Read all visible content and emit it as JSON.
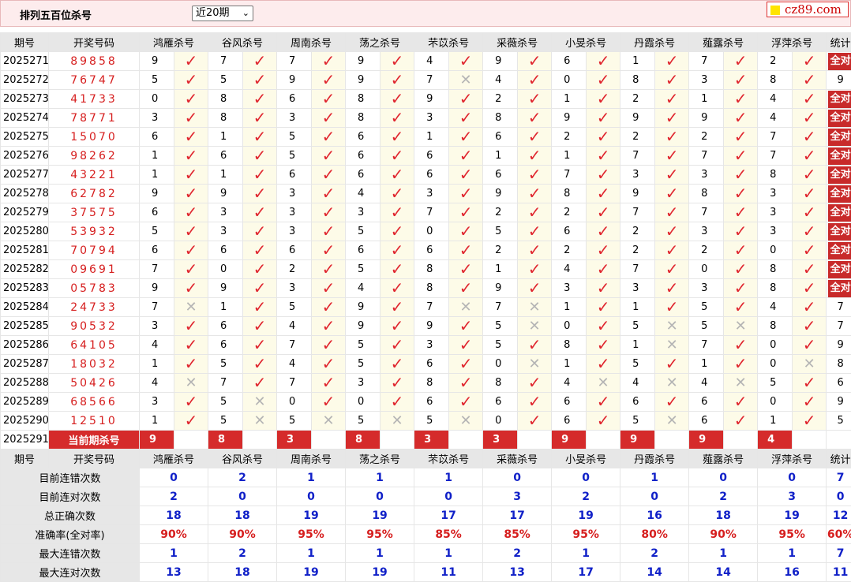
{
  "header": {
    "title": "排列五百位杀号",
    "period_select": "近20期",
    "logo_text": "cz89.com"
  },
  "columns": {
    "issue": "期号",
    "award": "开奖号码",
    "killers": [
      "鸿雁杀号",
      "谷风杀号",
      "周南杀号",
      "荡之杀号",
      "芣苡杀号",
      "采薇杀号",
      "小旻杀号",
      "丹霞杀号",
      "薤露杀号",
      "浮萍杀号"
    ],
    "stat": "统计"
  },
  "rows": [
    {
      "issue": "2025271",
      "award": "89858",
      "kills": [
        9,
        7,
        7,
        9,
        4,
        9,
        6,
        1,
        7,
        2
      ],
      "res": [
        1,
        1,
        1,
        1,
        1,
        1,
        1,
        1,
        1,
        1
      ],
      "stat": "全对"
    },
    {
      "issue": "2025272",
      "award": "76747",
      "kills": [
        5,
        5,
        9,
        9,
        7,
        4,
        0,
        8,
        3,
        8
      ],
      "res": [
        1,
        1,
        1,
        1,
        0,
        1,
        1,
        1,
        1,
        1
      ],
      "stat": "9"
    },
    {
      "issue": "2025273",
      "award": "41733",
      "kills": [
        0,
        8,
        6,
        8,
        9,
        2,
        1,
        2,
        1,
        4
      ],
      "res": [
        1,
        1,
        1,
        1,
        1,
        1,
        1,
        1,
        1,
        1
      ],
      "stat": "全对"
    },
    {
      "issue": "2025274",
      "award": "78771",
      "kills": [
        3,
        8,
        3,
        8,
        3,
        8,
        9,
        9,
        9,
        4
      ],
      "res": [
        1,
        1,
        1,
        1,
        1,
        1,
        1,
        1,
        1,
        1
      ],
      "stat": "全对"
    },
    {
      "issue": "2025275",
      "award": "15070",
      "kills": [
        6,
        1,
        5,
        6,
        1,
        6,
        2,
        2,
        2,
        7
      ],
      "res": [
        1,
        1,
        1,
        1,
        1,
        1,
        1,
        1,
        1,
        1
      ],
      "stat": "全对"
    },
    {
      "issue": "2025276",
      "award": "98262",
      "kills": [
        1,
        6,
        5,
        6,
        6,
        1,
        1,
        7,
        7,
        7
      ],
      "res": [
        1,
        1,
        1,
        1,
        1,
        1,
        1,
        1,
        1,
        1
      ],
      "stat": "全对"
    },
    {
      "issue": "2025277",
      "award": "43221",
      "kills": [
        1,
        1,
        6,
        6,
        6,
        6,
        7,
        3,
        3,
        8
      ],
      "res": [
        1,
        1,
        1,
        1,
        1,
        1,
        1,
        1,
        1,
        1
      ],
      "stat": "全对"
    },
    {
      "issue": "2025278",
      "award": "62782",
      "kills": [
        9,
        9,
        3,
        4,
        3,
        9,
        8,
        9,
        8,
        3
      ],
      "res": [
        1,
        1,
        1,
        1,
        1,
        1,
        1,
        1,
        1,
        1
      ],
      "stat": "全对"
    },
    {
      "issue": "2025279",
      "award": "37575",
      "kills": [
        6,
        3,
        3,
        3,
        7,
        2,
        2,
        7,
        7,
        3
      ],
      "res": [
        1,
        1,
        1,
        1,
        1,
        1,
        1,
        1,
        1,
        1
      ],
      "stat": "全对"
    },
    {
      "issue": "2025280",
      "award": "53932",
      "kills": [
        5,
        3,
        3,
        5,
        0,
        5,
        6,
        2,
        3,
        3
      ],
      "res": [
        1,
        1,
        1,
        1,
        1,
        1,
        1,
        1,
        1,
        1
      ],
      "stat": "全对"
    },
    {
      "issue": "2025281",
      "award": "70794",
      "kills": [
        6,
        6,
        6,
        6,
        6,
        2,
        2,
        2,
        2,
        0
      ],
      "res": [
        1,
        1,
        1,
        1,
        1,
        1,
        1,
        1,
        1,
        1
      ],
      "stat": "全对"
    },
    {
      "issue": "2025282",
      "award": "09691",
      "kills": [
        7,
        0,
        2,
        5,
        8,
        1,
        4,
        7,
        0,
        8
      ],
      "res": [
        1,
        1,
        1,
        1,
        1,
        1,
        1,
        1,
        1,
        1
      ],
      "stat": "全对"
    },
    {
      "issue": "2025283",
      "award": "05783",
      "kills": [
        9,
        9,
        3,
        4,
        8,
        9,
        3,
        3,
        3,
        8
      ],
      "res": [
        1,
        1,
        1,
        1,
        1,
        1,
        1,
        1,
        1,
        1
      ],
      "stat": "全对"
    },
    {
      "issue": "2025284",
      "award": "24733",
      "kills": [
        7,
        1,
        5,
        9,
        7,
        7,
        1,
        1,
        5,
        4
      ],
      "res": [
        0,
        1,
        1,
        1,
        0,
        0,
        1,
        1,
        1,
        1
      ],
      "stat": "7"
    },
    {
      "issue": "2025285",
      "award": "90532",
      "kills": [
        3,
        6,
        4,
        9,
        9,
        5,
        0,
        5,
        5,
        8
      ],
      "res": [
        1,
        1,
        1,
        1,
        1,
        0,
        1,
        0,
        0,
        1
      ],
      "stat": "7"
    },
    {
      "issue": "2025286",
      "award": "64105",
      "kills": [
        4,
        6,
        7,
        5,
        3,
        5,
        8,
        1,
        7,
        0
      ],
      "res": [
        1,
        1,
        1,
        1,
        1,
        1,
        1,
        0,
        1,
        1
      ],
      "stat": "9"
    },
    {
      "issue": "2025287",
      "award": "18032",
      "kills": [
        1,
        5,
        4,
        5,
        6,
        0,
        1,
        5,
        1,
        0
      ],
      "res": [
        1,
        1,
        1,
        1,
        1,
        0,
        1,
        1,
        1,
        0
      ],
      "stat": "8"
    },
    {
      "issue": "2025288",
      "award": "50426",
      "kills": [
        4,
        7,
        7,
        3,
        8,
        8,
        4,
        4,
        4,
        5
      ],
      "res": [
        0,
        1,
        1,
        1,
        1,
        1,
        0,
        0,
        0,
        1
      ],
      "stat": "6"
    },
    {
      "issue": "2025289",
      "award": "68566",
      "kills": [
        3,
        5,
        0,
        0,
        6,
        6,
        6,
        6,
        6,
        0
      ],
      "res": [
        1,
        0,
        1,
        1,
        1,
        1,
        1,
        1,
        1,
        1
      ],
      "stat": "9"
    },
    {
      "issue": "2025290",
      "award": "12510",
      "kills": [
        1,
        5,
        5,
        5,
        5,
        0,
        6,
        5,
        6,
        1
      ],
      "res": [
        1,
        0,
        0,
        0,
        0,
        1,
        1,
        0,
        1,
        1
      ],
      "stat": "5"
    }
  ],
  "current": {
    "issue": "2025291",
    "label": "当前期杀号",
    "kills": [
      "9",
      "8",
      "3",
      "8",
      "3",
      "3",
      "9",
      "9",
      "9",
      "4"
    ]
  },
  "stats": [
    {
      "label": "目前连错次数",
      "values": [
        "0",
        "2",
        "1",
        "1",
        "1",
        "0",
        "0",
        "1",
        "0",
        "0",
        "7"
      ],
      "color": "blue"
    },
    {
      "label": "目前连对次数",
      "values": [
        "2",
        "0",
        "0",
        "0",
        "0",
        "3",
        "2",
        "0",
        "2",
        "3",
        "0"
      ],
      "color": "blue"
    },
    {
      "label": "总正确次数",
      "values": [
        "18",
        "18",
        "19",
        "19",
        "17",
        "17",
        "19",
        "16",
        "18",
        "19",
        "12"
      ],
      "color": "blue"
    },
    {
      "label": "准确率(全对率)",
      "values": [
        "90%",
        "90%",
        "95%",
        "95%",
        "85%",
        "85%",
        "95%",
        "80%",
        "90%",
        "95%",
        "60%"
      ],
      "color": "red"
    },
    {
      "label": "最大连错次数",
      "values": [
        "1",
        "2",
        "1",
        "1",
        "1",
        "2",
        "1",
        "2",
        "1",
        "1",
        "7"
      ],
      "color": "blue"
    },
    {
      "label": "最大连对次数",
      "values": [
        "13",
        "18",
        "19",
        "19",
        "11",
        "13",
        "17",
        "14",
        "14",
        "16",
        "11"
      ],
      "color": "blue"
    }
  ],
  "icons": {
    "ok": "check-mark-icon",
    "bad": "cross-mark-icon"
  },
  "colors": {
    "accent": "#d52b2b",
    "ok": "#e0262f",
    "bad": "#b5b5b5",
    "blue": "#1020c8"
  }
}
